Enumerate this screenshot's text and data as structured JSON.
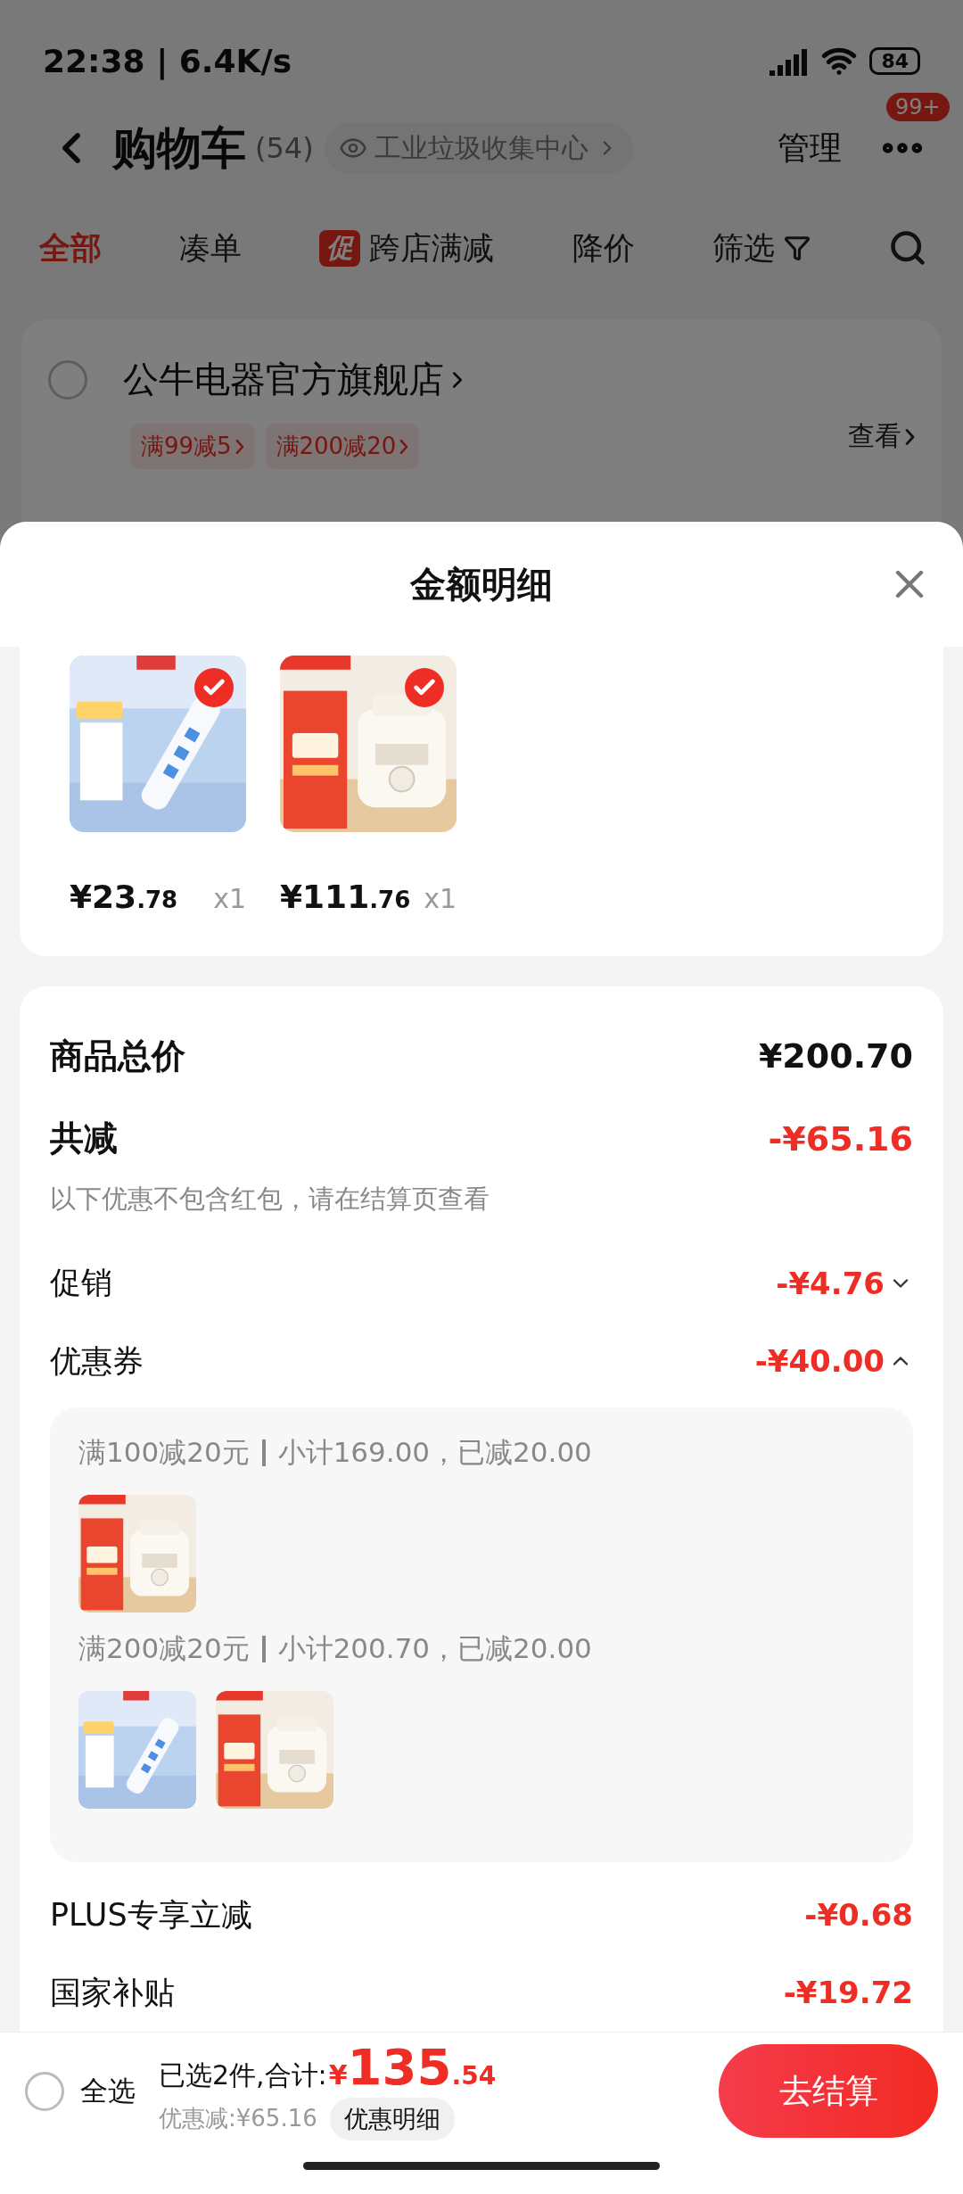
{
  "status_bar": {
    "time": "22:38 | 6.4K/s",
    "battery": "84"
  },
  "header": {
    "title": "购物车",
    "count": "(54)",
    "location": "工业垃圾收集中心",
    "manage": "管理",
    "badge": "99+"
  },
  "tabs": [
    {
      "kind": "plain",
      "label": "全部",
      "selected": true
    },
    {
      "kind": "plain",
      "label": "凑单",
      "selected": false
    },
    {
      "kind": "promo",
      "badge": "促",
      "label": "跨店满减",
      "selected": false
    },
    {
      "kind": "plain",
      "label": "降价",
      "selected": false
    },
    {
      "kind": "filter",
      "label": "筛选",
      "selected": false
    }
  ],
  "store": {
    "name": "公牛电器官方旗舰店",
    "checked": false,
    "tags": [
      "满99减5",
      "满200减20"
    ],
    "view": "查看"
  },
  "sheet": {
    "title": "金额明细",
    "products": [
      {
        "kind": "picture",
        "price": "¥23",
        "cents": ".78",
        "qty": "x1",
        "checked": true
      },
      {
        "kind": "picture",
        "price": "¥111",
        "cents": ".76",
        "qty": "x1",
        "checked": true
      }
    ],
    "total": {
      "label": "商品总价",
      "value": "¥200.70"
    },
    "discount": {
      "label": "共减",
      "value": "-¥65.16",
      "note": "以下优惠不包含红包，请在结算页查看"
    },
    "lines": [
      {
        "kind": "toggle",
        "label": "促销",
        "value": "-¥4.76",
        "expanded": false
      },
      {
        "kind": "toggle",
        "label": "优惠券",
        "value": "-¥40.00",
        "expanded": true,
        "coupons": [
          {
            "title": "满100减20元",
            "detail": "小计169.00，已减20.00"
          },
          {
            "title": "满200减20元",
            "detail": "小计200.70，已减20.00"
          }
        ]
      },
      {
        "kind": "plain",
        "label": "PLUS专享立减",
        "value": "-¥0.68"
      },
      {
        "kind": "plain",
        "label": "国家补贴",
        "value": "-¥19.72"
      }
    ]
  },
  "footer": {
    "select_all": "全选",
    "checked": false,
    "summary": "已选2件,合计:",
    "currency": "¥",
    "amount": "135",
    "cents": ".54",
    "saved": "优惠减:¥65.16",
    "detail_button": "优惠明细",
    "checkout": "去结算"
  }
}
